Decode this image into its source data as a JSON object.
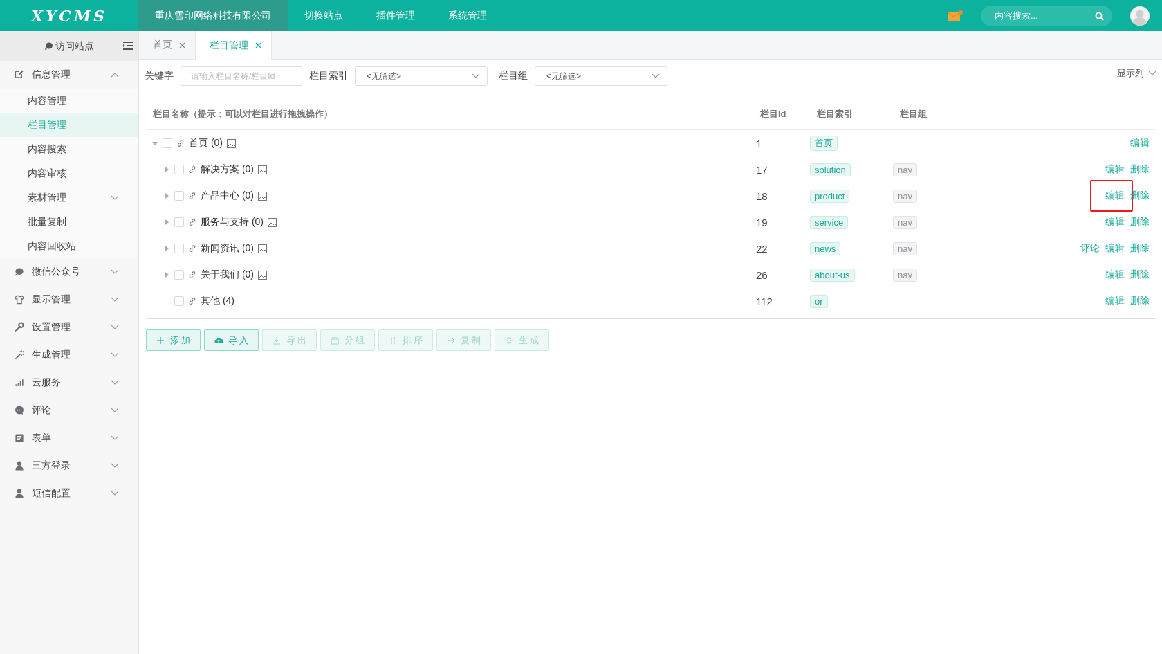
{
  "logo": "XYCMS",
  "top_nav": [
    {
      "label": "重庆雪印网络科技有限公司",
      "selected": true
    },
    {
      "label": "切换站点",
      "selected": false
    },
    {
      "label": "插件管理",
      "selected": false
    },
    {
      "label": "系统管理",
      "selected": false
    }
  ],
  "header_search": {
    "placeholder": "内容搜索..."
  },
  "sidebar": {
    "visit_site": "访问站点",
    "groups": [
      {
        "label": "信息管理",
        "expanded": true,
        "children": [
          {
            "label": "内容管理",
            "selected": false
          },
          {
            "label": "栏目管理",
            "selected": true
          },
          {
            "label": "内容搜索",
            "selected": false
          },
          {
            "label": "内容审核",
            "selected": false
          },
          {
            "label": "素材管理",
            "selected": false,
            "expanded": false
          },
          {
            "label": "批量复制",
            "selected": false
          },
          {
            "label": "内容回收站",
            "selected": false
          }
        ]
      },
      {
        "label": "微信公众号",
        "expanded": false
      },
      {
        "label": "显示管理",
        "expanded": false
      },
      {
        "label": "设置管理",
        "expanded": false
      },
      {
        "label": "生成管理",
        "expanded": false
      },
      {
        "label": "云服务",
        "expanded": false
      },
      {
        "label": "评论",
        "expanded": false
      },
      {
        "label": "表单",
        "expanded": false
      },
      {
        "label": "三方登录",
        "expanded": false
      },
      {
        "label": "短信配置",
        "expanded": false
      }
    ]
  },
  "tabs": [
    {
      "label": "首页",
      "selected": false
    },
    {
      "label": "栏目管理",
      "selected": true
    }
  ],
  "filters": {
    "keyword_label": "关键字",
    "keyword_placeholder": "请输入栏目名称/栏目Id",
    "index_label": "栏目索引",
    "index_value": "<无筛选>",
    "group_label": "栏目组",
    "group_value": "<无筛选>",
    "columns_button": "显示列"
  },
  "table": {
    "columns": [
      "栏目名称（提示：可以对栏目进行拖拽操作）",
      "栏目Id",
      "栏目索引",
      "栏目组"
    ],
    "rows": [
      {
        "name": "首页 (0)",
        "image_icon": true,
        "checked": false,
        "expanded": true,
        "id": "1",
        "index": "首页",
        "actions": [
          {
            "label": "编辑",
            "highlighted": false
          }
        ],
        "children": [
          {
            "name": "解决方案 (0)",
            "image_icon": true,
            "checked": false,
            "expanded": false,
            "id": "17",
            "index": "solution",
            "group": "nav",
            "actions": [
              {
                "label": "编辑",
                "highlighted": false
              },
              {
                "label": "删除",
                "highlighted": false
              }
            ]
          },
          {
            "name": "产品中心 (0)",
            "image_icon": true,
            "checked": false,
            "expanded": false,
            "id": "18",
            "index": "product",
            "group": "nav",
            "actions": [
              {
                "label": "编辑",
                "highlighted": true
              },
              {
                "label": "删除",
                "highlighted": false
              }
            ]
          },
          {
            "name": "服务与支持 (0)",
            "image_icon": true,
            "checked": false,
            "expanded": false,
            "id": "19",
            "index": "service",
            "group": "nav",
            "actions": [
              {
                "label": "编辑",
                "highlighted": false
              },
              {
                "label": "删除",
                "highlighted": false
              }
            ]
          },
          {
            "name": "新闻资讯 (0)",
            "image_icon": true,
            "checked": false,
            "expanded": false,
            "id": "22",
            "index": "news",
            "group": "nav",
            "actions": [
              {
                "label": "评论",
                "highlighted": false
              },
              {
                "label": "编辑",
                "highlighted": false
              },
              {
                "label": "删除",
                "highlighted": false
              }
            ]
          },
          {
            "name": "关于我们 (0)",
            "image_icon": true,
            "checked": false,
            "expanded": false,
            "id": "26",
            "index": "about-us",
            "group": "nav",
            "actions": [
              {
                "label": "编辑",
                "highlighted": false
              },
              {
                "label": "删除",
                "highlighted": false
              }
            ]
          },
          {
            "name": "其他 (4)",
            "image_icon": false,
            "checked": false,
            "id": "112",
            "index": "or",
            "actions": [
              {
                "label": "编辑",
                "highlighted": false
              },
              {
                "label": "删除",
                "highlighted": false
              }
            ]
          }
        ]
      }
    ]
  },
  "buttons": [
    {
      "label": "添 加",
      "disabled": false
    },
    {
      "label": "导 入",
      "disabled": false
    },
    {
      "label": "导 出",
      "disabled": true
    },
    {
      "label": "分 组",
      "disabled": true
    },
    {
      "label": "排 序",
      "disabled": true
    },
    {
      "label": "复 制",
      "disabled": true
    },
    {
      "label": "生 成",
      "disabled": true
    }
  ]
}
